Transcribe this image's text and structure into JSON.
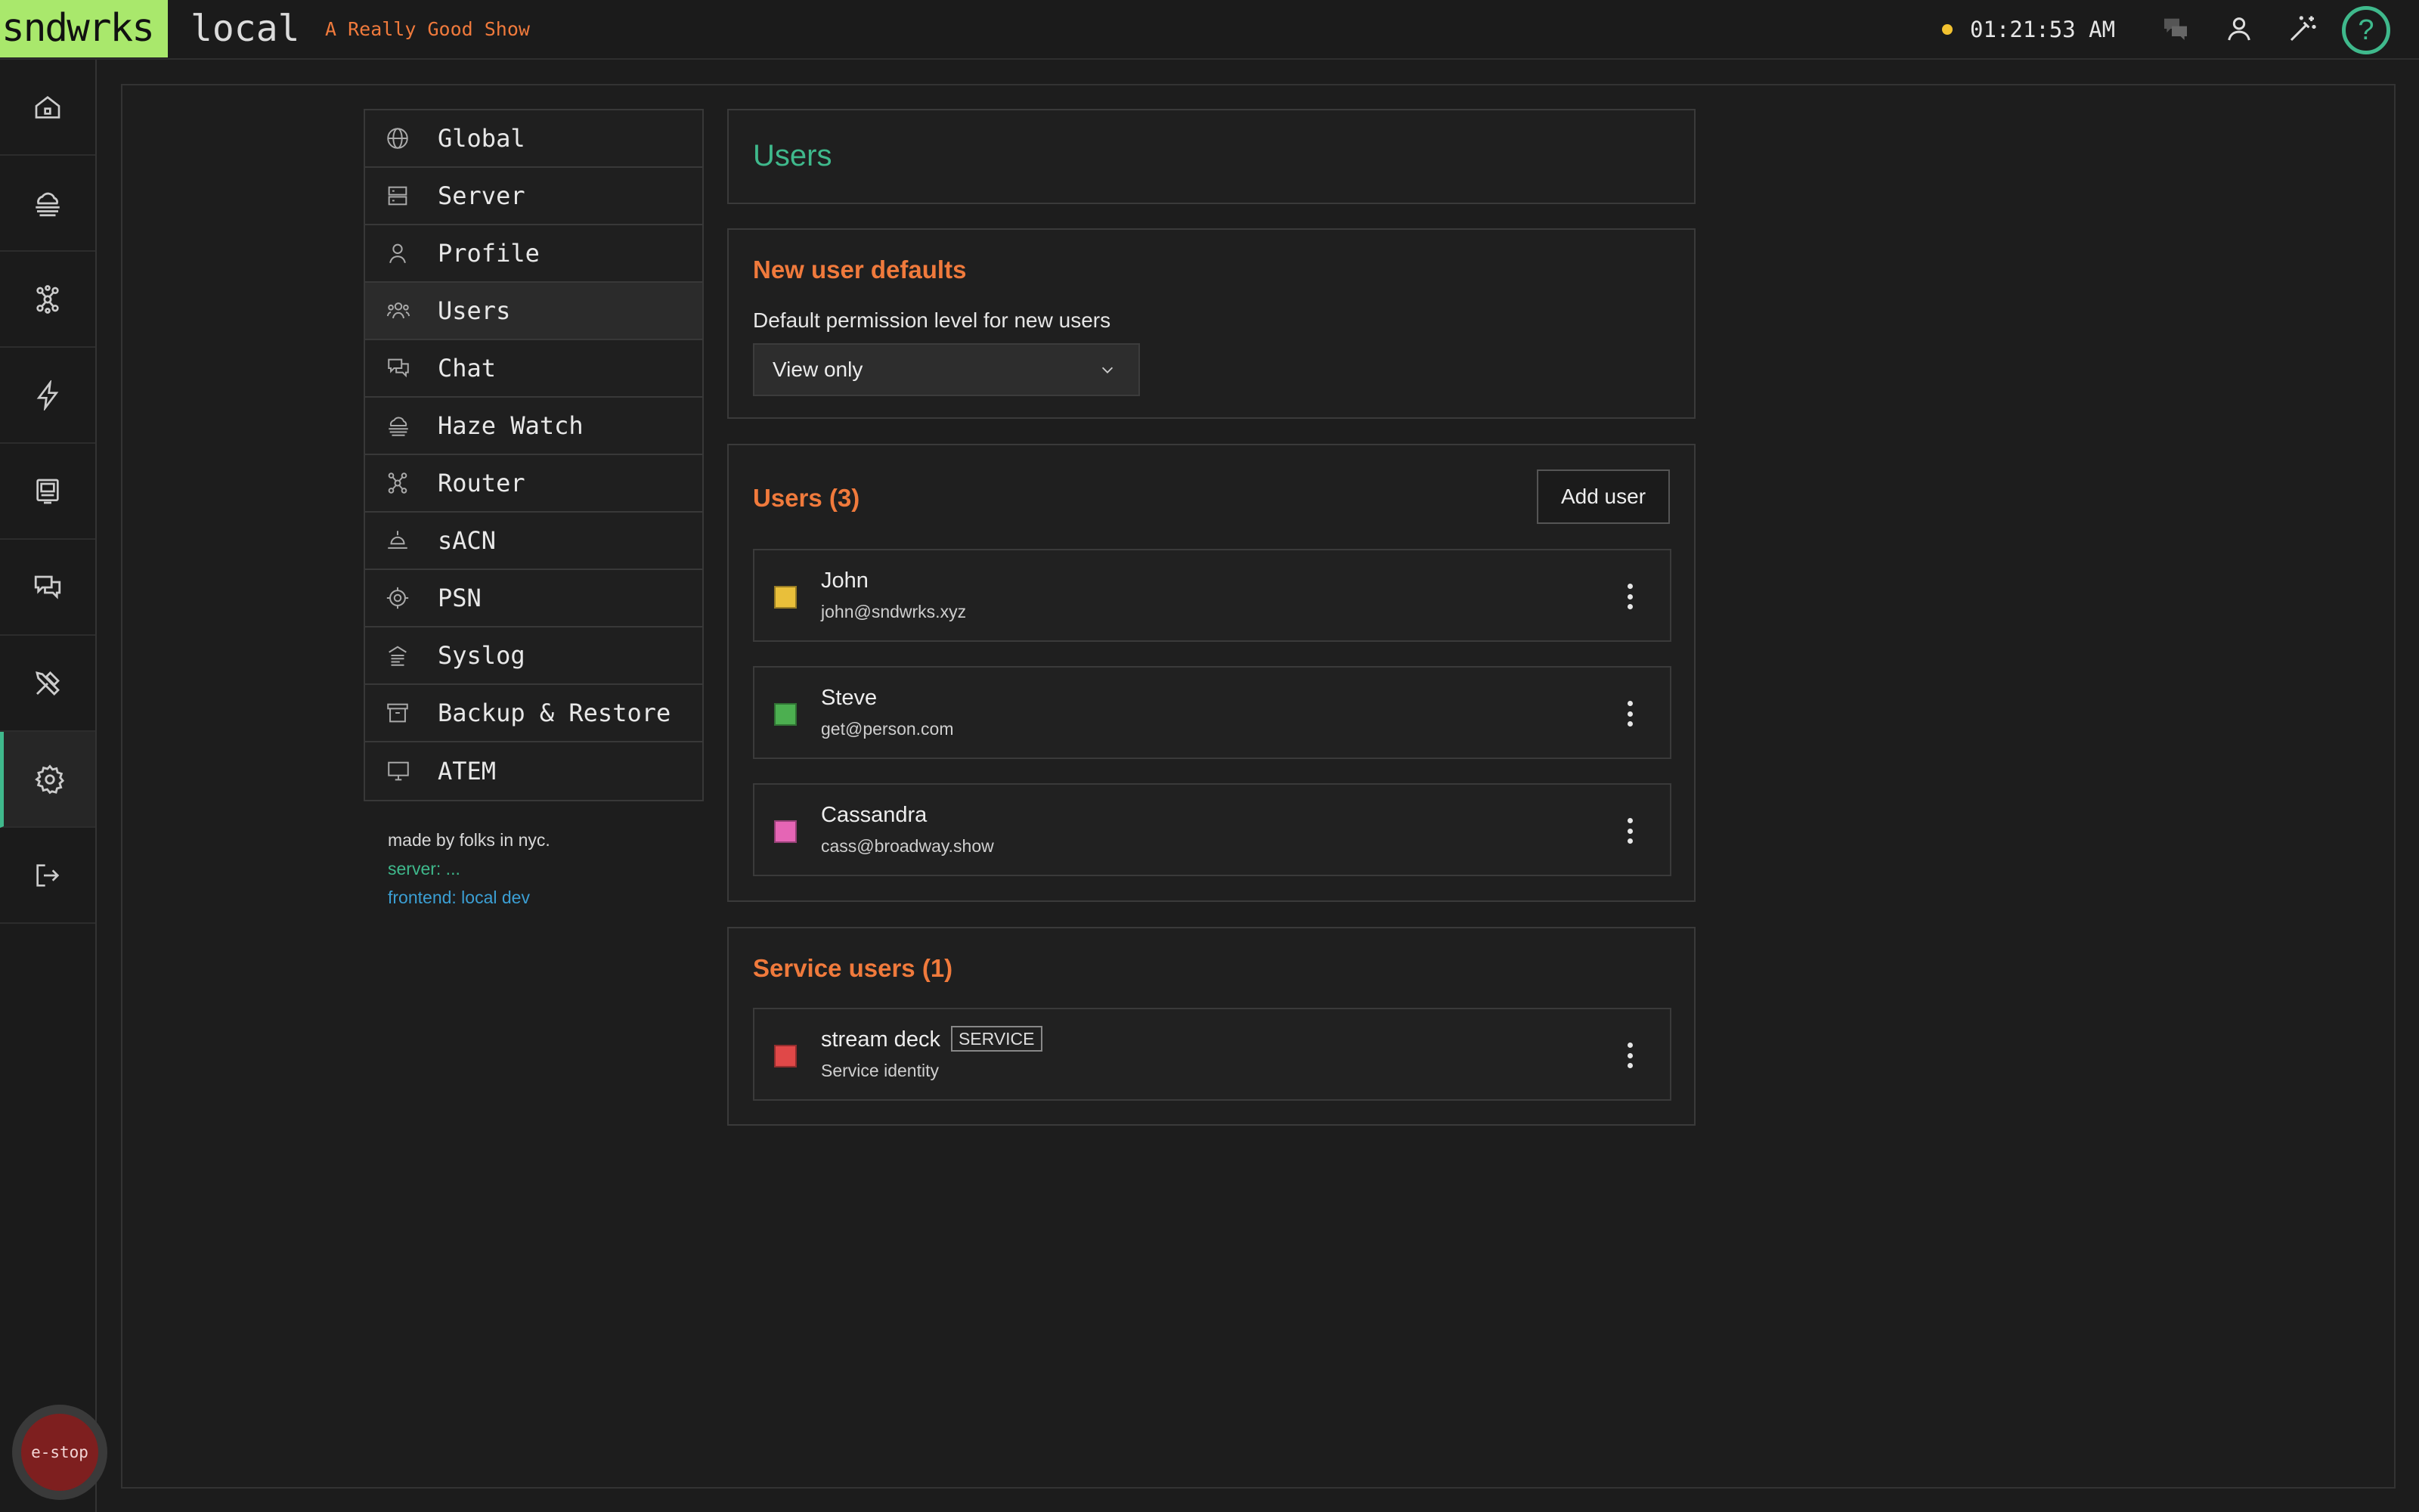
{
  "topbar": {
    "brand": "sndwrks",
    "environment": "local",
    "show_name": "A Really Good Show",
    "clock": "01:21:53 AM",
    "status_color": "#f2c230",
    "icons": [
      "chat-icon",
      "user-icon",
      "magic-wand-icon",
      "help-icon"
    ],
    "help_label": "?"
  },
  "leftnav": {
    "items": [
      {
        "name": "home",
        "icon": "home-icon"
      },
      {
        "name": "haze",
        "icon": "haze-icon"
      },
      {
        "name": "router",
        "icon": "network-icon"
      },
      {
        "name": "lightning",
        "icon": "lightning-icon"
      },
      {
        "name": "display",
        "icon": "display-icon"
      },
      {
        "name": "chat",
        "icon": "chat-icon"
      },
      {
        "name": "tools",
        "icon": "tools-icon"
      },
      {
        "name": "settings",
        "icon": "gear-icon",
        "active": true
      },
      {
        "name": "logout",
        "icon": "logout-icon"
      }
    ],
    "estop_label": "e-stop"
  },
  "settings_menu": {
    "items": [
      {
        "label": "Global",
        "icon": "globe-icon"
      },
      {
        "label": "Server",
        "icon": "server-icon"
      },
      {
        "label": "Profile",
        "icon": "user-icon"
      },
      {
        "label": "Users",
        "icon": "users-icon",
        "active": true
      },
      {
        "label": "Chat",
        "icon": "chat-icon"
      },
      {
        "label": "Haze Watch",
        "icon": "haze-icon"
      },
      {
        "label": "Router",
        "icon": "network-icon"
      },
      {
        "label": "sACN",
        "icon": "stage-light-icon"
      },
      {
        "label": "PSN",
        "icon": "target-icon"
      },
      {
        "label": "Syslog",
        "icon": "syslog-icon"
      },
      {
        "label": "Backup & Restore",
        "icon": "archive-icon"
      },
      {
        "label": "ATEM",
        "icon": "monitor-icon"
      }
    ]
  },
  "footer": {
    "made_by": "made by folks in nyc.",
    "server": "server: ...",
    "frontend": "frontend: local dev"
  },
  "page": {
    "title": "Users"
  },
  "defaults": {
    "title": "New user defaults",
    "permission_label": "Default permission level for new users",
    "permission_value": "View only"
  },
  "users": {
    "title": "Users (3)",
    "add_label": "Add user",
    "list": [
      {
        "name": "John",
        "email": "john@sndwrks.xyz",
        "color": "#e9bf3a"
      },
      {
        "name": "Steve",
        "email": "get@person.com",
        "color": "#4caf50"
      },
      {
        "name": "Cassandra",
        "email": "cass@broadway.show",
        "color": "#e565b5"
      }
    ]
  },
  "service_users": {
    "title": "Service users (1)",
    "list": [
      {
        "name": "stream deck",
        "badge": "SERVICE",
        "subtitle": "Service identity",
        "color": "#e04848"
      }
    ]
  }
}
